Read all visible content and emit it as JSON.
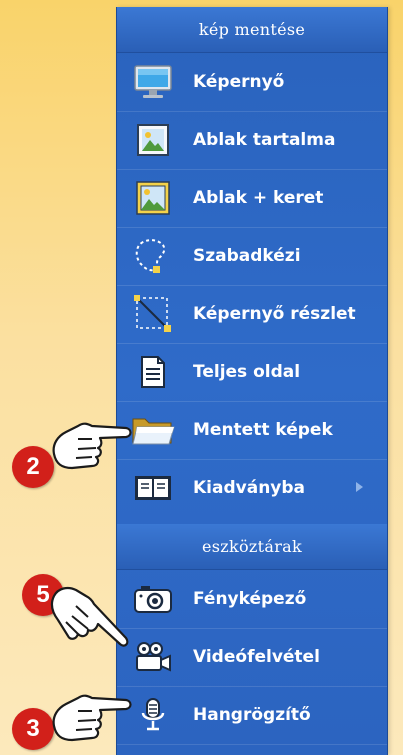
{
  "sections": {
    "save": {
      "header": "kép mentése"
    },
    "toolbars": {
      "header": "eszköztárak"
    }
  },
  "items": [
    {
      "label": "Képernyő",
      "icon": "monitor-icon"
    },
    {
      "label": "Ablak tartalma",
      "icon": "window-content-icon"
    },
    {
      "label": "Ablak + keret",
      "icon": "window-frame-icon"
    },
    {
      "label": "Szabadkézi",
      "icon": "freehand-lasso-icon"
    },
    {
      "label": "Képernyő részlet",
      "icon": "region-select-icon"
    },
    {
      "label": "Teljes oldal",
      "icon": "full-page-icon"
    },
    {
      "label": "Mentett képek",
      "icon": "folder-icon"
    },
    {
      "label": "Kiadványba",
      "icon": "book-icon",
      "has_submenu": true
    },
    {
      "label": "Fényképező",
      "icon": "camera-icon"
    },
    {
      "label": "Videófelvétel",
      "icon": "video-camera-icon"
    },
    {
      "label": "Hangrögzítő",
      "icon": "microphone-icon"
    }
  ],
  "callouts": [
    {
      "number": "2",
      "icon": "pointing-hand-icon"
    },
    {
      "number": "5",
      "icon": "pointing-hand-icon"
    },
    {
      "number": "3",
      "icon": "pointing-hand-icon"
    }
  ],
  "colors": {
    "menu_bg": "#2f6bc9",
    "header_bg": "#2a5fb6",
    "badge": "#d2201a",
    "page_bg": "#fbe0a0"
  }
}
